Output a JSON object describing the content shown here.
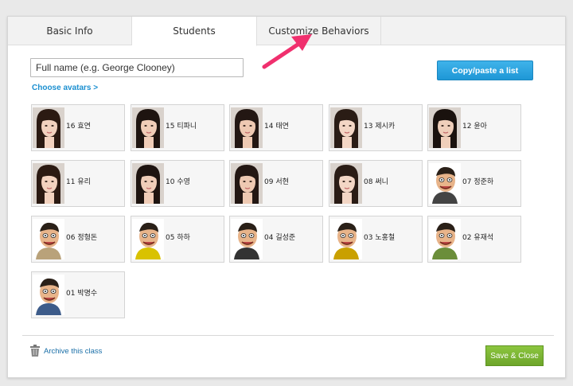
{
  "tabs": [
    {
      "label": "Basic Info"
    },
    {
      "label": "Students"
    },
    {
      "label": "Customize Behaviors"
    }
  ],
  "name_input": {
    "placeholder": "Full name (e.g. George Clooney)",
    "value": ""
  },
  "choose_avatars": "Choose avatars >",
  "copy_paste_button": "Copy/paste a list",
  "students": [
    {
      "label": "16 효연",
      "avatar": "girl-photo"
    },
    {
      "label": "15 티파니",
      "avatar": "girl-photo"
    },
    {
      "label": "14 태연",
      "avatar": "girl-photo"
    },
    {
      "label": "13 제시카",
      "avatar": "girl-photo"
    },
    {
      "label": "12 윤아",
      "avatar": "girl-photo"
    },
    {
      "label": "11 유리",
      "avatar": "girl-photo"
    },
    {
      "label": "10 수영",
      "avatar": "girl-photo"
    },
    {
      "label": "09 서현",
      "avatar": "girl-photo"
    },
    {
      "label": "08 써니",
      "avatar": "girl-photo"
    },
    {
      "label": "07 정준하",
      "avatar": "caricature"
    },
    {
      "label": "06 정형돈",
      "avatar": "caricature"
    },
    {
      "label": "05 하하",
      "avatar": "caricature"
    },
    {
      "label": "04 길성준",
      "avatar": "caricature"
    },
    {
      "label": "03 노홍철",
      "avatar": "caricature"
    },
    {
      "label": "02 유재석",
      "avatar": "caricature"
    },
    {
      "label": "01 박명수",
      "avatar": "caricature"
    }
  ],
  "archive_label": "Archive this class",
  "save_button": "Save & Close",
  "colors": {
    "accent_blue": "#1e97d6",
    "save_green": "#7ab733",
    "arrow_pink": "#f0306e"
  }
}
